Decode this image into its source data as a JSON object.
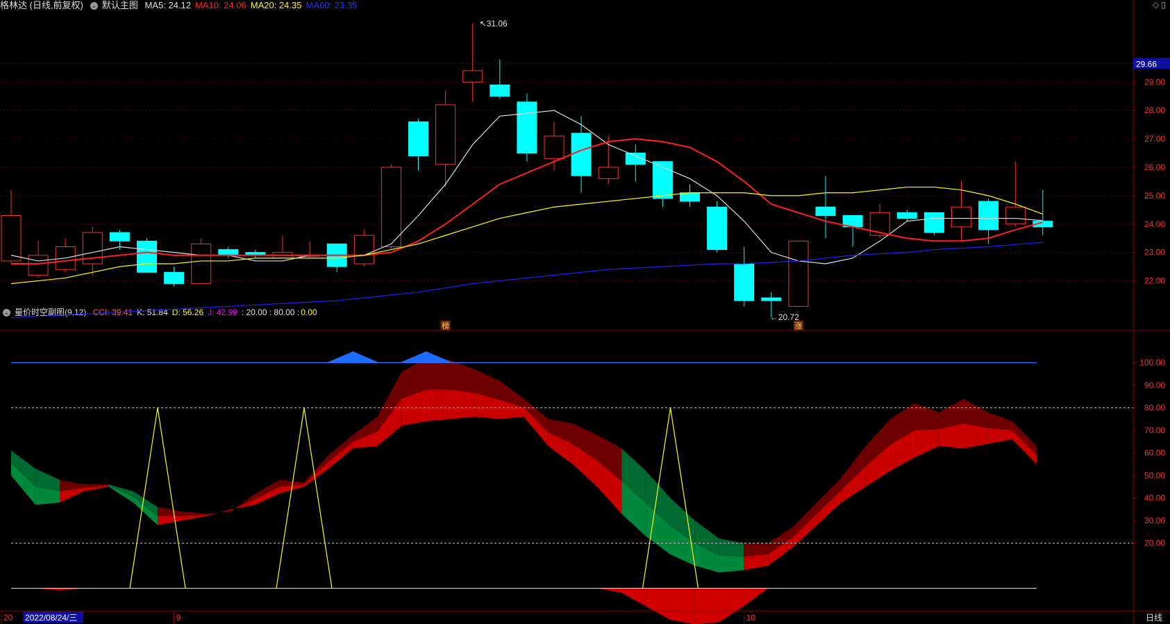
{
  "main_header": {
    "stock": "格林达 (日线,前复权)",
    "template": "默认主图",
    "ma": [
      {
        "label": "MA5: 24.12",
        "color": "#e0e0e0"
      },
      {
        "label": "MA10: 24.06",
        "color": "#ff2020"
      },
      {
        "label": "MA20: 24.35",
        "color": "#ffff00"
      },
      {
        "label": "MA60: 23.35",
        "color": "#3030ff"
      }
    ]
  },
  "sub_header": {
    "title": "量价时空副图(9,12)",
    "items": [
      {
        "label": "CCI: 39.41",
        "color": "#ff6060"
      },
      {
        "label": "K: 51.84",
        "color": "#e0e0e0"
      },
      {
        "label": "D: 56.26",
        "color": "#ffff00"
      },
      {
        "label": "J: 42.99",
        "color": "#ff00ff"
      },
      {
        "label": ": 20.00 : 80.00 :",
        "color": "#e0e0e0"
      },
      {
        "label": "0.00",
        "color": "#ffff00"
      }
    ]
  },
  "top_right_icons": [
    "diamond-icon",
    "window-icon"
  ],
  "timeframe": "日线",
  "chart_data": [
    {
      "type": "candlestick",
      "price_axis": {
        "ticks": [
          "22.00",
          "23.00",
          "24.00",
          "25.00",
          "26.00",
          "27.00",
          "28.00",
          "29.00"
        ],
        "ylim": [
          20.4,
          31.5
        ]
      },
      "current_price": "29.66",
      "annotations": [
        {
          "text": "31.06",
          "candle": 17,
          "kind": "high"
        },
        {
          "text": "20.72",
          "candle": 28,
          "kind": "low"
        },
        {
          "text": "榜",
          "candle": 16
        },
        {
          "text": "涨",
          "candle": 29
        }
      ],
      "candles": [
        {
          "o": 22.7,
          "h": 25.2,
          "l": 22.6,
          "c": 24.3
        },
        {
          "o": 22.2,
          "h": 23.4,
          "l": 22.1,
          "c": 22.9
        },
        {
          "o": 22.4,
          "h": 23.5,
          "l": 22.3,
          "c": 23.2
        },
        {
          "o": 22.6,
          "h": 23.9,
          "l": 22.2,
          "c": 23.7
        },
        {
          "o": 23.7,
          "h": 23.8,
          "l": 23.1,
          "c": 23.4
        },
        {
          "o": 23.4,
          "h": 23.5,
          "l": 22.3,
          "c": 22.3
        },
        {
          "o": 22.3,
          "h": 22.5,
          "l": 21.8,
          "c": 21.9
        },
        {
          "o": 21.9,
          "h": 23.5,
          "l": 21.9,
          "c": 23.3
        },
        {
          "o": 23.1,
          "h": 23.2,
          "l": 22.8,
          "c": 22.9
        },
        {
          "o": 23.0,
          "h": 23.1,
          "l": 22.8,
          "c": 22.9
        },
        {
          "o": 22.8,
          "h": 23.6,
          "l": 22.8,
          "c": 23.0
        },
        {
          "o": 22.9,
          "h": 23.4,
          "l": 22.8,
          "c": 22.9
        },
        {
          "o": 23.3,
          "h": 23.3,
          "l": 22.3,
          "c": 22.5
        },
        {
          "o": 22.6,
          "h": 23.8,
          "l": 22.5,
          "c": 23.6
        },
        {
          "o": 23.2,
          "h": 26.1,
          "l": 23.1,
          "c": 26.0
        },
        {
          "o": 27.6,
          "h": 27.7,
          "l": 25.9,
          "c": 26.4
        },
        {
          "o": 26.1,
          "h": 28.7,
          "l": 25.3,
          "c": 28.2
        },
        {
          "o": 29.0,
          "h": 31.06,
          "l": 28.3,
          "c": 29.4
        },
        {
          "o": 28.9,
          "h": 29.8,
          "l": 28.4,
          "c": 28.5
        },
        {
          "o": 28.3,
          "h": 28.6,
          "l": 26.2,
          "c": 26.5
        },
        {
          "o": 26.3,
          "h": 27.6,
          "l": 25.9,
          "c": 27.1
        },
        {
          "o": 27.2,
          "h": 27.8,
          "l": 25.1,
          "c": 25.7
        },
        {
          "o": 25.6,
          "h": 27.1,
          "l": 25.4,
          "c": 26.0
        },
        {
          "o": 26.5,
          "h": 26.8,
          "l": 25.5,
          "c": 26.1
        },
        {
          "o": 26.2,
          "h": 26.2,
          "l": 24.6,
          "c": 24.9
        },
        {
          "o": 25.1,
          "h": 25.4,
          "l": 24.6,
          "c": 24.8
        },
        {
          "o": 24.6,
          "h": 24.8,
          "l": 23.0,
          "c": 23.1
        },
        {
          "o": 22.6,
          "h": 23.2,
          "l": 21.1,
          "c": 21.3
        },
        {
          "o": 21.4,
          "h": 21.6,
          "l": 20.72,
          "c": 21.3
        },
        {
          "o": 21.1,
          "h": 23.4,
          "l": 21.1,
          "c": 23.4
        },
        {
          "o": 24.6,
          "h": 25.7,
          "l": 23.5,
          "c": 24.3
        },
        {
          "o": 24.3,
          "h": 24.3,
          "l": 23.2,
          "c": 23.9
        },
        {
          "o": 23.6,
          "h": 24.7,
          "l": 23.5,
          "c": 24.4
        },
        {
          "o": 24.4,
          "h": 24.5,
          "l": 24.1,
          "c": 24.2
        },
        {
          "o": 24.4,
          "h": 24.4,
          "l": 23.6,
          "c": 23.7
        },
        {
          "o": 23.9,
          "h": 25.5,
          "l": 23.4,
          "c": 24.6
        },
        {
          "o": 24.8,
          "h": 24.9,
          "l": 23.3,
          "c": 23.8
        },
        {
          "o": 24.0,
          "h": 26.2,
          "l": 23.9,
          "c": 24.6
        },
        {
          "o": 24.1,
          "h": 25.2,
          "l": 23.6,
          "c": 23.9
        }
      ],
      "ma_series": [
        {
          "name": "MA5",
          "color": "#e0e0e0",
          "values": [
            22.9,
            22.7,
            22.8,
            23.0,
            23.2,
            23.1,
            23.0,
            22.9,
            22.9,
            22.7,
            22.7,
            22.9,
            22.9,
            22.9,
            23.3,
            24.3,
            25.4,
            26.8,
            27.8,
            27.9,
            28.0,
            27.5,
            26.8,
            26.4,
            26.0,
            25.6,
            25.0,
            24.1,
            23.0,
            22.7,
            22.6,
            22.8,
            23.4,
            24.1,
            24.2,
            24.2,
            24.2,
            24.2,
            24.12
          ]
        },
        {
          "name": "MA10",
          "color": "#ff2020",
          "values": [
            22.6,
            22.6,
            22.7,
            22.8,
            22.9,
            23.0,
            22.9,
            22.9,
            22.9,
            22.9,
            22.9,
            22.9,
            22.9,
            22.9,
            23.0,
            23.4,
            24.0,
            24.7,
            25.4,
            25.8,
            26.2,
            26.6,
            26.9,
            27.0,
            26.9,
            26.7,
            26.2,
            25.5,
            24.7,
            24.4,
            24.1,
            23.9,
            23.7,
            23.5,
            23.4,
            23.4,
            23.5,
            23.8,
            24.06
          ]
        },
        {
          "name": "MA20",
          "color": "#ffff00",
          "values": [
            21.9,
            22.0,
            22.1,
            22.3,
            22.5,
            22.6,
            22.6,
            22.7,
            22.7,
            22.8,
            22.8,
            22.8,
            22.8,
            22.9,
            23.1,
            23.3,
            23.6,
            23.9,
            24.2,
            24.4,
            24.6,
            24.7,
            24.8,
            24.9,
            25.0,
            25.1,
            25.1,
            25.1,
            25.0,
            25.0,
            25.1,
            25.1,
            25.2,
            25.3,
            25.3,
            25.2,
            25.0,
            24.7,
            24.35
          ]
        },
        {
          "name": "MA60",
          "color": "#2020ff",
          "values": [
            20.7,
            20.75,
            20.8,
            20.85,
            20.9,
            20.95,
            21.0,
            21.05,
            21.1,
            21.15,
            21.2,
            21.25,
            21.3,
            21.4,
            21.5,
            21.6,
            21.75,
            21.9,
            22.0,
            22.1,
            22.2,
            22.3,
            22.4,
            22.45,
            22.5,
            22.55,
            22.6,
            22.6,
            22.65,
            22.7,
            22.8,
            22.9,
            22.95,
            23.0,
            23.1,
            23.15,
            23.2,
            23.28,
            23.35
          ]
        }
      ]
    },
    {
      "type": "area",
      "y_axis": {
        "ticks": [
          "20.00",
          "30.00",
          "40.00",
          "50.00",
          "60.00",
          "70.00",
          "80.00",
          "90.00",
          "100.00"
        ],
        "ylim": [
          -10,
          110
        ]
      },
      "x_labels": [
        {
          "text": "20",
          "index": 0
        },
        {
          "text": "9",
          "index": 6
        },
        {
          "text": "10",
          "index": 27
        }
      ],
      "date_label": "2022/08/24/三",
      "ref_lines": [
        0,
        20,
        80,
        100
      ],
      "k_band": [
        [
          61,
          50
        ],
        [
          53,
          37
        ],
        [
          48,
          38
        ],
        [
          46,
          43
        ],
        [
          46,
          45
        ],
        [
          43,
          38
        ],
        [
          36,
          28
        ],
        [
          34,
          30
        ],
        [
          33,
          32
        ],
        [
          34,
          35
        ],
        [
          42,
          37
        ],
        [
          48,
          42
        ],
        [
          47,
          45
        ],
        [
          59,
          53
        ],
        [
          68,
          62
        ],
        [
          76,
          63
        ],
        [
          96,
          72
        ],
        [
          102,
          74
        ],
        [
          101,
          75
        ],
        [
          97,
          76
        ],
        [
          92,
          75
        ],
        [
          84,
          76
        ],
        [
          75,
          63
        ],
        [
          73,
          55
        ],
        [
          68,
          45
        ],
        [
          62,
          33
        ],
        [
          52,
          23
        ],
        [
          40,
          15
        ],
        [
          30,
          10
        ],
        [
          22,
          7
        ],
        [
          20,
          8
        ],
        [
          20,
          10
        ],
        [
          27,
          18
        ],
        [
          38,
          28
        ],
        [
          49,
          38
        ],
        [
          63,
          45
        ],
        [
          75,
          52
        ],
        [
          82,
          58
        ],
        [
          78,
          63
        ],
        [
          84,
          62
        ],
        [
          78,
          64
        ],
        [
          74,
          66
        ],
        [
          63,
          55
        ]
      ],
      "j_band": [
        [
          22,
          0
        ],
        [
          5,
          0
        ],
        [
          0,
          -1
        ],
        [
          0,
          0
        ],
        [
          0,
          0
        ],
        [
          0,
          0
        ],
        [
          0,
          0
        ],
        [
          0,
          0
        ],
        [
          0,
          0
        ],
        [
          0,
          0
        ],
        [
          0,
          0
        ],
        [
          0,
          0
        ],
        [
          0,
          0
        ],
        [
          0,
          0
        ],
        [
          0,
          0
        ],
        [
          0,
          0
        ],
        [
          0,
          0
        ],
        [
          0,
          0
        ],
        [
          0,
          0
        ],
        [
          0,
          0
        ],
        [
          0,
          0
        ],
        [
          0,
          0
        ],
        [
          0,
          0
        ],
        [
          0,
          0
        ],
        [
          0,
          0
        ],
        [
          0,
          -2
        ],
        [
          0,
          -8
        ],
        [
          0,
          -14
        ],
        [
          0,
          -16
        ],
        [
          0,
          -15
        ],
        [
          0,
          -8
        ],
        [
          0,
          0
        ],
        [
          0,
          0
        ],
        [
          0,
          0
        ],
        [
          0,
          0
        ],
        [
          0,
          0
        ],
        [
          0,
          0
        ],
        [
          0,
          0
        ],
        [
          0,
          0
        ],
        [
          0,
          0
        ],
        [
          0,
          0
        ],
        [
          0,
          0
        ],
        [
          0,
          0
        ]
      ],
      "signal_spikes": [
        6,
        12,
        27
      ],
      "top_markers": [
        14,
        17
      ]
    }
  ]
}
